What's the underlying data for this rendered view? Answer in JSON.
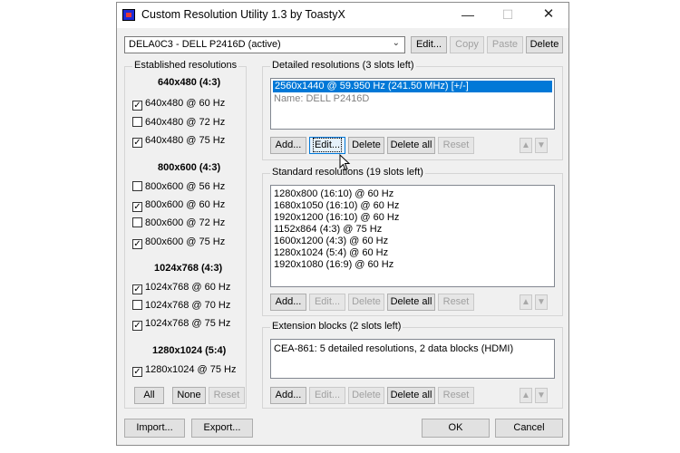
{
  "window": {
    "title": "Custom Resolution Utility 1.3 by ToastyX",
    "minimize": "—",
    "maximize": "☐",
    "close": "✕"
  },
  "monitor": {
    "selected": "DELA0C3 - DELL P2416D (active)",
    "edit_label": "Edit...",
    "copy_label": "Copy",
    "paste_label": "Paste",
    "delete_label": "Delete"
  },
  "established": {
    "title": "Established resolutions",
    "groups": [
      {
        "header": "640x480 (4:3)",
        "items": [
          {
            "label": "640x480 @ 60 Hz",
            "checked": true
          },
          {
            "label": "640x480 @ 72 Hz",
            "checked": false
          },
          {
            "label": "640x480 @ 75 Hz",
            "checked": true
          }
        ]
      },
      {
        "header": "800x600 (4:3)",
        "items": [
          {
            "label": "800x600 @ 56 Hz",
            "checked": false
          },
          {
            "label": "800x600 @ 60 Hz",
            "checked": true
          },
          {
            "label": "800x600 @ 72 Hz",
            "checked": false
          },
          {
            "label": "800x600 @ 75 Hz",
            "checked": true
          }
        ]
      },
      {
        "header": "1024x768 (4:3)",
        "items": [
          {
            "label": "1024x768 @ 60 Hz",
            "checked": true
          },
          {
            "label": "1024x768 @ 70 Hz",
            "checked": false
          },
          {
            "label": "1024x768 @ 75 Hz",
            "checked": true
          }
        ]
      },
      {
        "header": "1280x1024 (5:4)",
        "items": [
          {
            "label": "1280x1024 @ 75 Hz",
            "checked": true
          }
        ]
      }
    ],
    "all_label": "All",
    "none_label": "None",
    "reset_label": "Reset"
  },
  "detailed": {
    "title": "Detailed resolutions (3 slots left)",
    "items": [
      {
        "text": "2560x1440 @ 59.950 Hz (241.50 MHz) [+/-]",
        "selected": true
      },
      {
        "text": "Name: DELL P2416D",
        "selected": false
      }
    ],
    "add_label": "Add...",
    "edit_label": "Edit...",
    "delete_label": "Delete",
    "delete_all_label": "Delete all",
    "reset_label": "Reset",
    "up_label": "▲",
    "down_label": "▼"
  },
  "standard": {
    "title": "Standard resolutions (19 slots left)",
    "items": [
      "1280x800 (16:10) @ 60 Hz",
      "1680x1050 (16:10) @ 60 Hz",
      "1920x1200 (16:10) @ 60 Hz",
      "1152x864 (4:3) @ 75 Hz",
      "1600x1200 (4:3) @ 60 Hz",
      "1280x1024 (5:4) @ 60 Hz",
      "1920x1080 (16:9) @ 60 Hz"
    ],
    "add_label": "Add...",
    "edit_label": "Edit...",
    "delete_label": "Delete",
    "delete_all_label": "Delete all",
    "reset_label": "Reset",
    "up_label": "▲",
    "down_label": "▼"
  },
  "extension": {
    "title": "Extension blocks (2 slots left)",
    "items": [
      "CEA-861: 5 detailed resolutions, 2 data blocks (HDMI)"
    ],
    "add_label": "Add...",
    "edit_label": "Edit...",
    "delete_label": "Delete",
    "delete_all_label": "Delete all",
    "reset_label": "Reset",
    "up_label": "▲",
    "down_label": "▼"
  },
  "footer": {
    "import_label": "Import...",
    "export_label": "Export...",
    "ok_label": "OK",
    "cancel_label": "Cancel"
  },
  "colors": {
    "selection": "#0078d7",
    "window_bg": "#f0f0f0",
    "app_icon": "#1d2bd6"
  }
}
